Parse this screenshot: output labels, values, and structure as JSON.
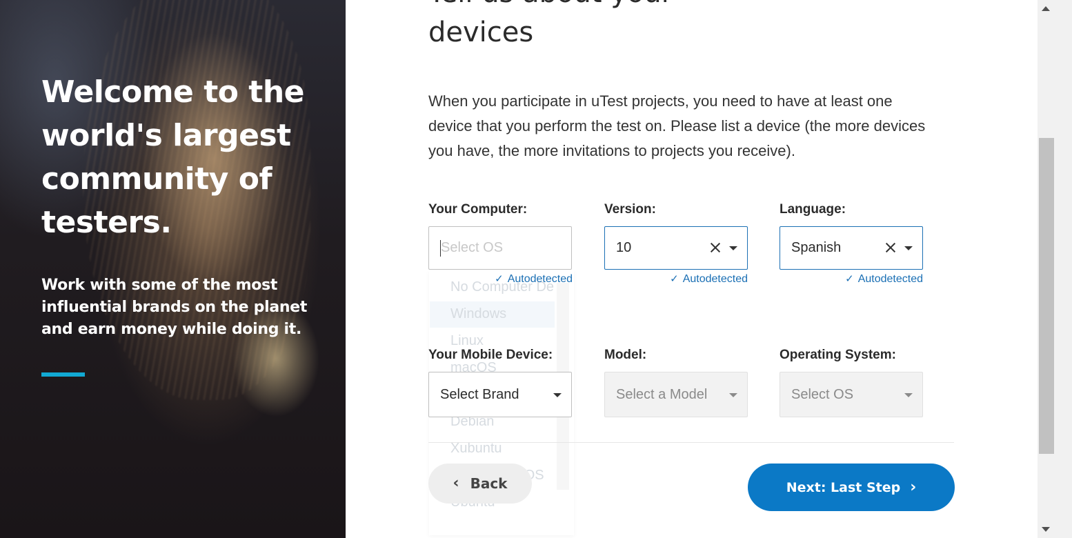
{
  "hero": {
    "title": "Welcome to the world's largest community of testers.",
    "subtitle": "Work with some of the most influential brands on the planet and earn money while doing it.",
    "accent_color": "#12a9d3"
  },
  "main": {
    "heading_line1": "Tell us about your",
    "heading_line2": "devices",
    "intro": "When you participate in uTest projects, you need to have at least one device that you perform the test on. Please list a device (the more devices you have, the more invitations to projects you receive)."
  },
  "computer": {
    "label": "Your Computer:",
    "placeholder": "Select OS",
    "autodetected": "Autodetected",
    "dropdown_options": [
      "No Computer De",
      "Windows",
      "Linux",
      "macOS",
      "Debian",
      "Xubuntu",
      "Elementary OS",
      "Ubuntu"
    ]
  },
  "version": {
    "label": "Version:",
    "value": "10",
    "autodetected": "Autodetected"
  },
  "language": {
    "label": "Language:",
    "value": "Spanish",
    "autodetected": "Autodetected"
  },
  "mobile": {
    "label": "Your Mobile Device:",
    "value": "Select Brand"
  },
  "model": {
    "label": "Model:",
    "value": "Select a Model"
  },
  "mobile_os": {
    "label": "Operating System:",
    "value": "Select OS"
  },
  "nav": {
    "back_label": "Back",
    "next_label": "Next: Last Step"
  },
  "colors": {
    "primary": "#0b79c6",
    "link": "#1a6fb4"
  },
  "icons": {
    "check": "checkmark-icon",
    "clear": "close-icon",
    "dropdown": "caret-down-icon",
    "back": "chevron-left-icon",
    "next": "chevron-right-icon"
  }
}
